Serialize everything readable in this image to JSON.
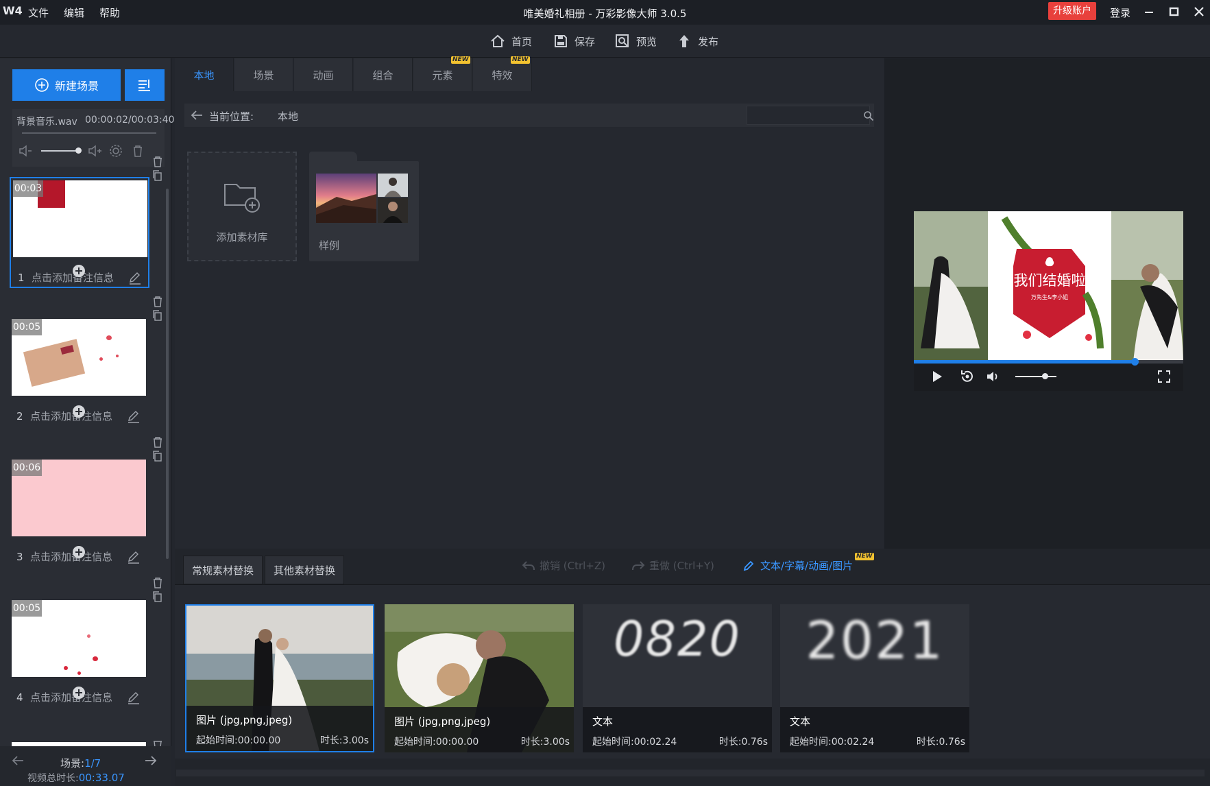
{
  "titlebar": {
    "logo": "W4",
    "menus": [
      "文件",
      "编辑",
      "帮助"
    ],
    "title": "唯美婚礼相册 - 万彩影像大师 3.0.5",
    "upgrade": "升级账户",
    "login": "登录"
  },
  "toolbar": {
    "home": "首页",
    "save": "保存",
    "preview": "预览",
    "publish": "发布"
  },
  "left": {
    "new_scene": "新建场景",
    "music": {
      "name": "背景音乐.wav",
      "time": "00:00:02/00:03:40"
    },
    "scenes": [
      {
        "index": "1",
        "duration": "00:03",
        "note": "点击添加备注信息"
      },
      {
        "index": "2",
        "duration": "00:05",
        "note": "点击添加备注信息"
      },
      {
        "index": "3",
        "duration": "00:06",
        "note": "点击添加备注信息"
      },
      {
        "index": "4",
        "duration": "00:05",
        "note": "点击添加备注信息"
      }
    ],
    "footer": {
      "scene_label": "场景:",
      "scene_current": "1/7",
      "total_label": "视频总时长:",
      "total_time": "00:33.07"
    }
  },
  "center": {
    "tabs": [
      {
        "label": "本地",
        "new": false
      },
      {
        "label": "场景",
        "new": false
      },
      {
        "label": "动画",
        "new": false
      },
      {
        "label": "组合",
        "new": false
      },
      {
        "label": "元素",
        "new": true
      },
      {
        "label": "特效",
        "new": true
      }
    ],
    "new_badge": "NEW",
    "path_label": "当前位置:",
    "path_value": "本地",
    "search_placeholder": "",
    "add_library": "添加素材库",
    "sample": "样例"
  },
  "preview": {
    "title_text": "我们结婚啦",
    "subtitle_text": "万先生&李小姐",
    "progress": 0.82,
    "volume": 0.72
  },
  "bottom": {
    "tabs": [
      "常规素材替换",
      "其他素材替换"
    ],
    "undo": "撤销 (Ctrl+Z)",
    "redo": "重做 (Ctrl+Y)",
    "text_link": "文本/字幕/动画/图片",
    "cards": [
      {
        "type": "图片 (jpg,png,jpeg)",
        "start": "起始时间:00:00.00",
        "length": "时长:3.00s"
      },
      {
        "type": "图片 (jpg,png,jpeg)",
        "start": "起始时间:00:00.00",
        "length": "时长:3.00s"
      },
      {
        "type": "文本",
        "start": "起始时间:00:02.24",
        "length": "时长:0.76s",
        "text": "0820"
      },
      {
        "type": "文本",
        "start": "起始时间:00:02.24",
        "length": "时长:0.76s",
        "text": "2021"
      }
    ]
  },
  "colors": {
    "accent": "#1f7fe8",
    "upgrade": "#e8403c",
    "bg": "#23262d"
  }
}
